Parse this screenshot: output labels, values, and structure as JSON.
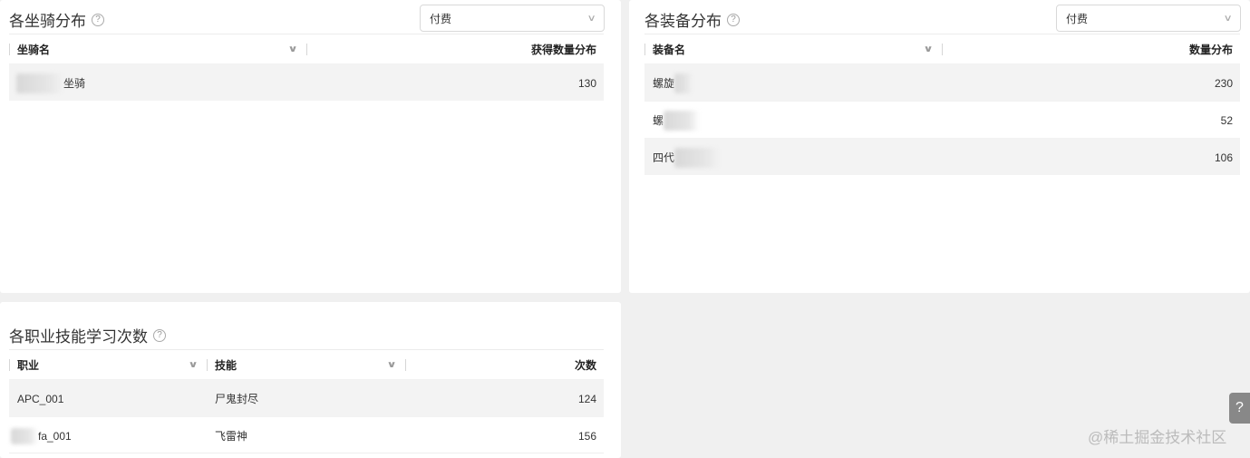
{
  "mount_panel": {
    "title": "各坐骑分布",
    "help_icon": "?",
    "filter_value": "付费",
    "columns": [
      "坐骑名",
      "获得数量分布"
    ],
    "rows": [
      {
        "name": "坐骑",
        "value": "130"
      }
    ]
  },
  "equip_panel": {
    "title": "各装备分布",
    "help_icon": "?",
    "filter_value": "付费",
    "columns": [
      "装备名",
      "数量分布"
    ],
    "rows": [
      {
        "name": "螺旋",
        "value": "230"
      },
      {
        "name": "螺",
        "value": "52"
      },
      {
        "name": "四代",
        "value": "106"
      }
    ]
  },
  "skill_panel": {
    "title": "各职业技能学习次数",
    "help_icon": "?",
    "columns": [
      "职业",
      "技能",
      "次数"
    ],
    "rows": [
      {
        "job": "APC_001",
        "skill": "尸鬼封尽",
        "count": "124"
      },
      {
        "job": "fa_001",
        "skill": "飞雷神",
        "count": "156"
      }
    ]
  },
  "help_fab": "?",
  "watermark": "@稀土掘金技术社区"
}
